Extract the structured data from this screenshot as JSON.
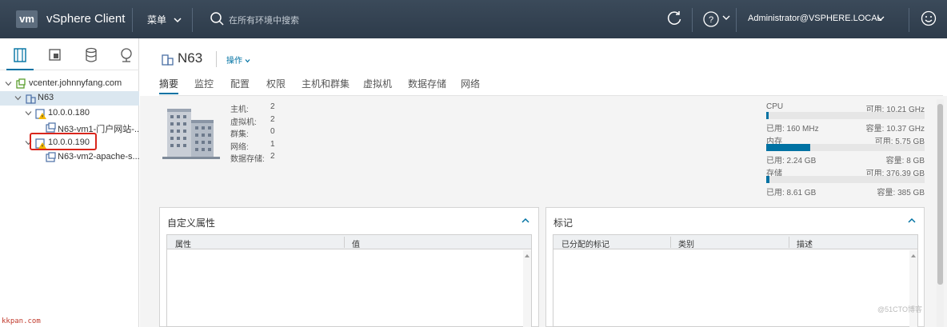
{
  "header": {
    "logo_text": "vm",
    "app_title": "vSphere Client",
    "menu_label": "菜单",
    "search_placeholder": "在所有环境中搜索",
    "user": "Administrator@VSPHERE.LOCAL",
    "icons": [
      "refresh-icon",
      "help-icon",
      "smile-icon"
    ]
  },
  "sidebar": {
    "tabs": [
      "hosts-clusters-icon",
      "vms-templates-icon",
      "storage-icon",
      "network-icon"
    ],
    "tree": [
      {
        "label": "vcenter.johnnyfang.com",
        "type": "vcenter"
      },
      {
        "label": "N63",
        "type": "datacenter",
        "selected": true
      },
      {
        "label": "10.0.0.180",
        "type": "host-warning"
      },
      {
        "label": "N63-vm1-门户网站-...",
        "type": "vm"
      },
      {
        "label": "10.0.0.190",
        "type": "host-warning",
        "highlighted": true
      },
      {
        "label": "N63-vm2-apache-s...",
        "type": "vm"
      }
    ]
  },
  "main": {
    "title": "N63",
    "actions_label": "操作",
    "tabs": [
      "摘要",
      "监控",
      "配置",
      "权限",
      "主机和群集",
      "虚拟机",
      "数据存储",
      "网络"
    ],
    "active_tab": "摘要",
    "summary": [
      {
        "key": "主机:",
        "value": "2"
      },
      {
        "key": "虚拟机:",
        "value": "2"
      },
      {
        "key": "群集:",
        "value": "0"
      },
      {
        "key": "网络:",
        "value": "1"
      },
      {
        "key": "数据存储:",
        "value": "2"
      }
    ],
    "resources": [
      {
        "name": "CPU",
        "free": "可用: 10.21 GHz",
        "used": "已用: 160 MHz",
        "capacity": "容量: 10.37 GHz",
        "fill": 0.015
      },
      {
        "name": "内存",
        "free": "可用: 5.75 GB",
        "used": "已用: 2.24 GB",
        "capacity": "容量: 8 GB",
        "fill": 0.28
      },
      {
        "name": "存储",
        "free": "可用: 376.39 GB",
        "used": "已用: 8.61 GB",
        "capacity": "容量: 385 GB",
        "fill": 0.022
      }
    ],
    "custom_attrs": {
      "title": "自定义属性",
      "columns": [
        "属性",
        "值"
      ]
    },
    "tags": {
      "title": "标记",
      "columns": [
        "已分配的标记",
        "类别",
        "描述"
      ]
    }
  },
  "watermarks": {
    "left": "kkpan.com",
    "right": "@51CTO博客"
  },
  "colors": {
    "header_bg": "#2d3b4a",
    "accent": "#0072a3",
    "highlight_box": "#d9261c",
    "warning": "#f5b800"
  }
}
